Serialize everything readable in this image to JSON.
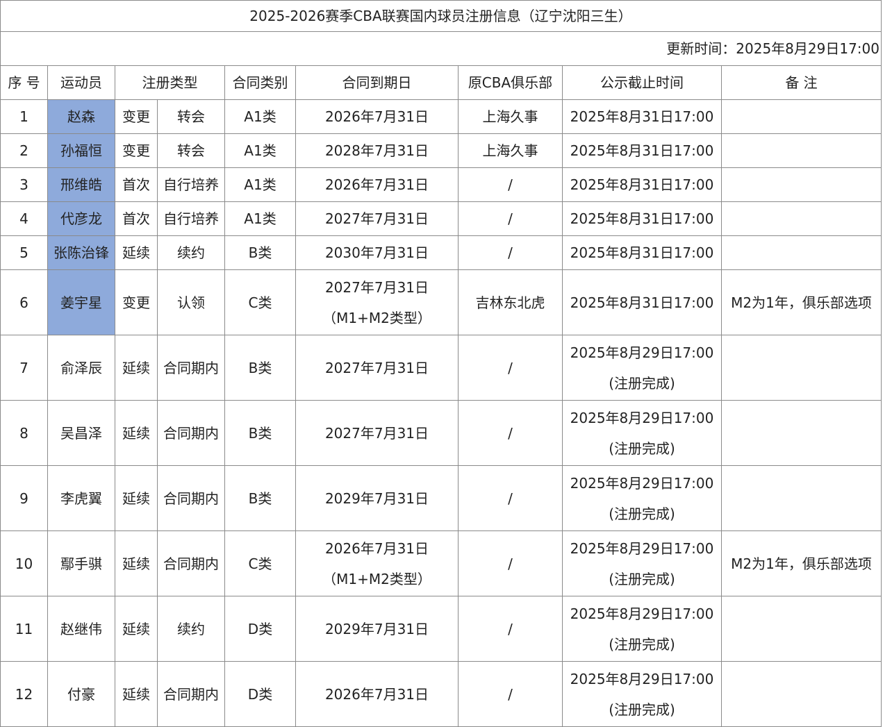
{
  "title": "2025-2026赛季CBA联赛国内球员注册信息（辽宁沈阳三生）",
  "update_time": "更新时间：2025年8月29日17:00",
  "headers": {
    "seq": "序 号",
    "player": "运动员",
    "reg_type": "注册类型",
    "contract_class": "合同类别",
    "expiry": "合同到期日",
    "orig_club": "原CBA俱乐部",
    "deadline": "公示截止时间",
    "note": "备 注"
  },
  "rows": [
    {
      "seq": "1",
      "player": "赵森",
      "type1": "变更",
      "type2": "转会",
      "cls": "A1类",
      "expiry": "2026年7月31日",
      "expiry_sub": "",
      "club": "上海久事",
      "deadline": "2025年8月31日17:00",
      "deadline_sub": "",
      "note": ""
    },
    {
      "seq": "2",
      "player": "孙福恒",
      "type1": "变更",
      "type2": "转会",
      "cls": "A1类",
      "expiry": "2028年7月31日",
      "expiry_sub": "",
      "club": "上海久事",
      "deadline": "2025年8月31日17:00",
      "deadline_sub": "",
      "note": ""
    },
    {
      "seq": "3",
      "player": "邢维皓",
      "type1": "首次",
      "type2": "自行培养",
      "cls": "A1类",
      "expiry": "2026年7月31日",
      "expiry_sub": "",
      "club": "/",
      "deadline": "2025年8月31日17:00",
      "deadline_sub": "",
      "note": ""
    },
    {
      "seq": "4",
      "player": "代彦龙",
      "type1": "首次",
      "type2": "自行培养",
      "cls": "A1类",
      "expiry": "2027年7月31日",
      "expiry_sub": "",
      "club": "/",
      "deadline": "2025年8月31日17:00",
      "deadline_sub": "",
      "note": ""
    },
    {
      "seq": "5",
      "player": "张陈治锋",
      "type1": "延续",
      "type2": "续约",
      "cls": "B类",
      "expiry": "2030年7月31日",
      "expiry_sub": "",
      "club": "/",
      "deadline": "2025年8月31日17:00",
      "deadline_sub": "",
      "note": ""
    },
    {
      "seq": "6",
      "player": "姜宇星",
      "type1": "变更",
      "type2": "认领",
      "cls": "C类",
      "expiry": "2027年7月31日",
      "expiry_sub": "（M1+M2类型）",
      "club": "吉林东北虎",
      "deadline": "2025年8月31日17:00",
      "deadline_sub": "",
      "note": "M2为1年，俱乐部选项"
    },
    {
      "seq": "7",
      "player": "俞泽辰",
      "type1": "延续",
      "type2": "合同期内",
      "cls": "B类",
      "expiry": "2027年7月31日",
      "expiry_sub": "",
      "club": "/",
      "deadline": "2025年8月29日17:00",
      "deadline_sub": "(注册完成)",
      "note": ""
    },
    {
      "seq": "8",
      "player": "吴昌泽",
      "type1": "延续",
      "type2": "合同期内",
      "cls": "B类",
      "expiry": "2027年7月31日",
      "expiry_sub": "",
      "club": "/",
      "deadline": "2025年8月29日17:00",
      "deadline_sub": "(注册完成)",
      "note": ""
    },
    {
      "seq": "9",
      "player": "李虎翼",
      "type1": "延续",
      "type2": "合同期内",
      "cls": "B类",
      "expiry": "2029年7月31日",
      "expiry_sub": "",
      "club": "/",
      "deadline": "2025年8月29日17:00",
      "deadline_sub": "(注册完成)",
      "note": ""
    },
    {
      "seq": "10",
      "player": "鄢手骐",
      "type1": "延续",
      "type2": "合同期内",
      "cls": "C类",
      "expiry": "2026年7月31日",
      "expiry_sub": "（M1+M2类型）",
      "club": "/",
      "deadline": "2025年8月29日17:00",
      "deadline_sub": "(注册完成)",
      "note": "M2为1年，俱乐部选项"
    },
    {
      "seq": "11",
      "player": "赵继伟",
      "type1": "延续",
      "type2": "续约",
      "cls": "D类",
      "expiry": "2029年7月31日",
      "expiry_sub": "",
      "club": "/",
      "deadline": "2025年8月29日17:00",
      "deadline_sub": "(注册完成)",
      "note": ""
    },
    {
      "seq": "12",
      "player": "付豪",
      "type1": "延续",
      "type2": "合同期内",
      "cls": "D类",
      "expiry": "2026年7月31日",
      "expiry_sub": "",
      "club": "/",
      "deadline": "2025年8月29日17:00",
      "deadline_sub": "(注册完成)",
      "note": ""
    }
  ],
  "colors": {
    "highlight": "#8eaadb",
    "border": "#8a8a8a"
  }
}
